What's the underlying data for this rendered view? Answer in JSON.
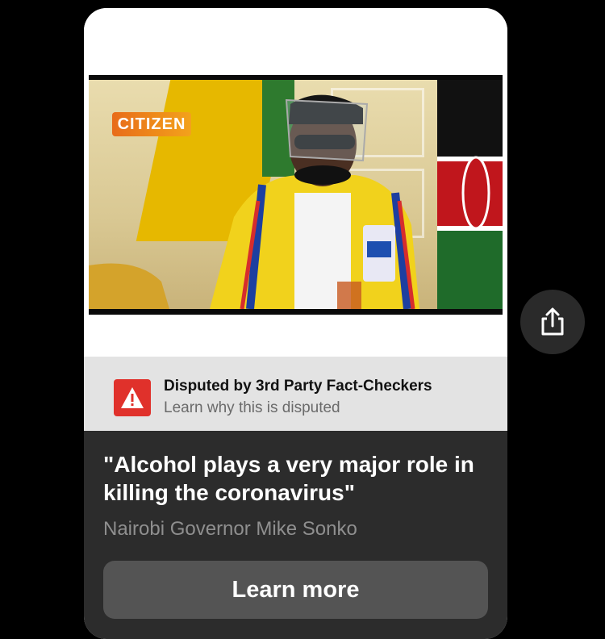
{
  "video": {
    "logo_text": "CITIZEN"
  },
  "fact_check": {
    "icon": "warning-icon",
    "title": "Disputed by 3rd Party Fact-Checkers",
    "subtitle": "Learn why this is disputed"
  },
  "post": {
    "quote": "\"Alcohol plays a very major role in killing the coronavirus\"",
    "attribution": "Nairobi Governor Mike Sonko",
    "learn_more_label": "Learn more"
  },
  "share": {
    "icon": "share-icon"
  },
  "colors": {
    "background": "#000000",
    "fact_bar": "#e3e3e3",
    "warning_red": "#e0312b",
    "info_panel": "#2c2c2c",
    "button": "#545454"
  }
}
